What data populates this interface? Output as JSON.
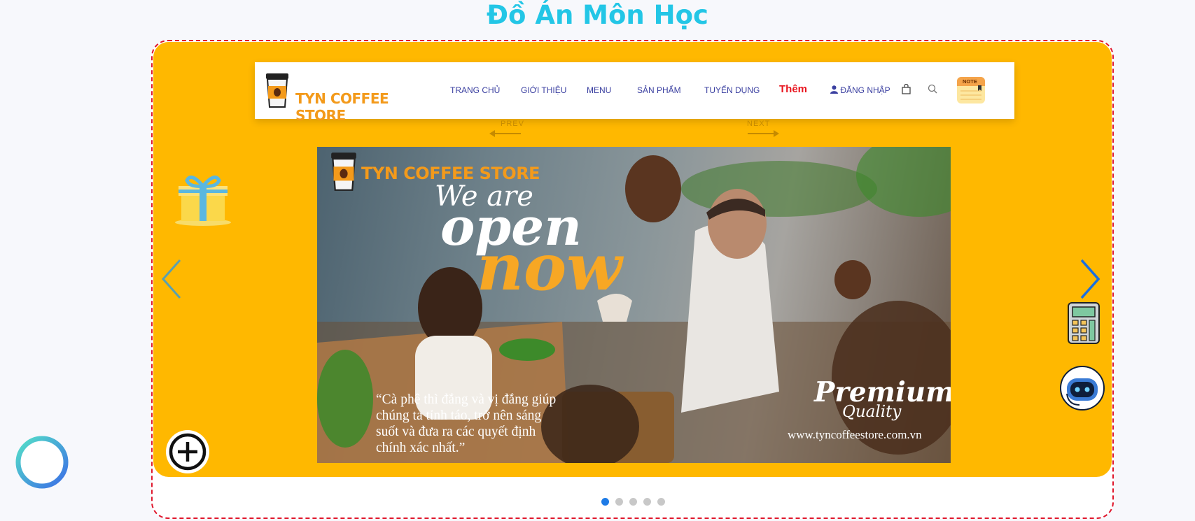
{
  "page": {
    "title": "Đồ Án Môn Học"
  },
  "navbar": {
    "brand": "TYN COFFEE STORE",
    "items": [
      "TRANG CHỦ",
      "GIỚI THIỆU",
      "MENU",
      "SẢN PHẨM",
      "TUYỂN DỤNG"
    ],
    "more_label": "Thêm",
    "login_label": "ĐĂNG NHẬP",
    "note_label": "NOTE"
  },
  "carousel": {
    "prev_label": "PREV",
    "next_label": "NEXT",
    "slide": {
      "brand": "TYN COFFEE STORE",
      "headline_1": "We are",
      "headline_2": "open",
      "headline_3": "now",
      "quote": "“Cà phê thì đắng và vị đắng giúp chúng ta tỉnh táo, trở nên sáng suốt và đưa ra các quyết định chính xác nhất.”",
      "premium": "Premium",
      "quality": "Quality",
      "website": "www.tyncoffeestore.com.vn"
    },
    "dots": [
      {
        "active": true
      },
      {
        "active": false
      },
      {
        "active": false
      },
      {
        "active": false
      },
      {
        "active": false
      }
    ]
  },
  "colors": {
    "title": "#23c6e6",
    "stage": "#ffb800",
    "frame_border": "#e0182d",
    "nav_text": "#3a3fa0",
    "nav_more": "#e8141e",
    "brand_orange": "#f39a1b",
    "dot_active": "#1e7be6"
  },
  "icons": {
    "widgets": [
      "gift-icon",
      "calculator-icon",
      "chatbot-icon",
      "plus-circle-icon",
      "plus-gradient-icon"
    ],
    "nav": [
      "user-icon",
      "shopping-bag-icon",
      "search-icon",
      "note-icon"
    ],
    "carousel": [
      "chevron-left-icon",
      "chevron-right-icon"
    ]
  }
}
